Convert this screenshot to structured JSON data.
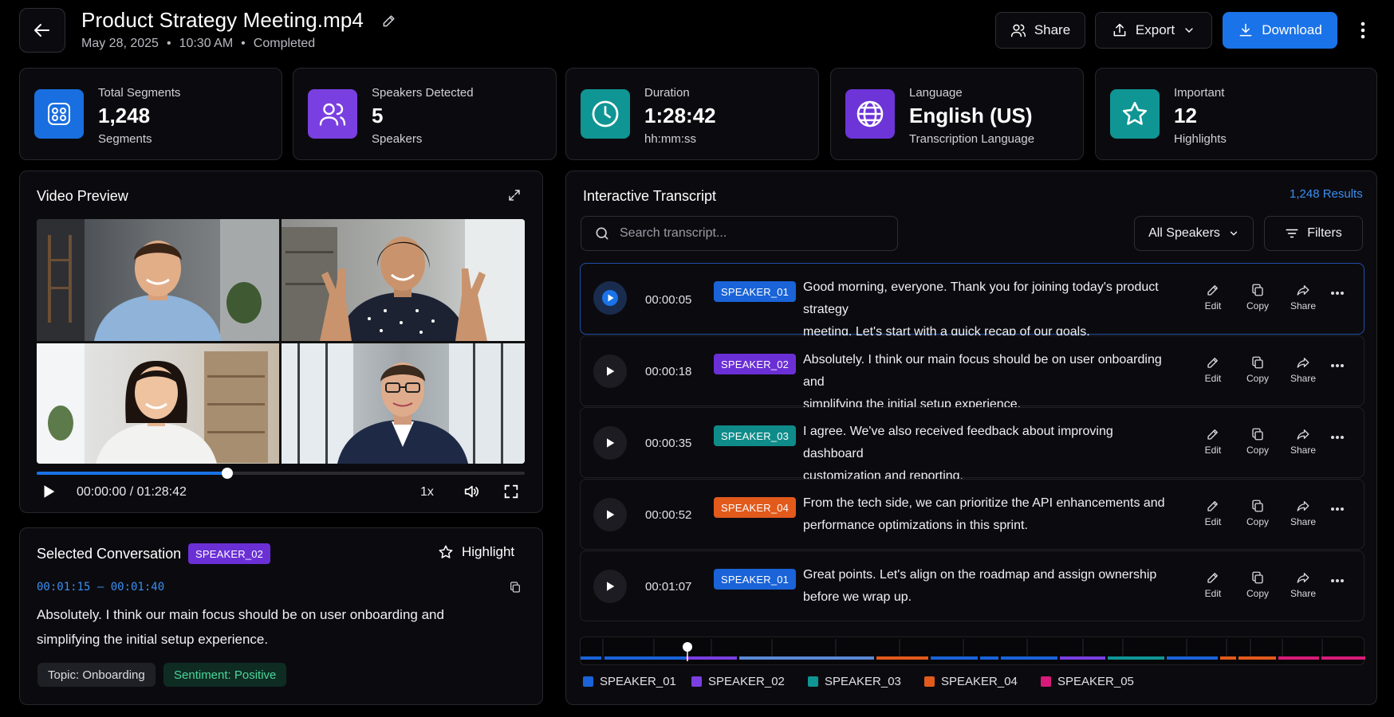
{
  "header": {
    "title": "Product Strategy Meeting.mp4",
    "date": "May 28, 2025",
    "time": "10:30 AM",
    "status": "Completed",
    "share_label": "Share",
    "export_label": "Export",
    "download_label": "Download"
  },
  "stats": [
    {
      "label": "Total Segments",
      "value": "1,248",
      "sub": "Segments",
      "icon": "segments-icon",
      "color": "#1a6fe0"
    },
    {
      "label": "Speakers Detected",
      "value": "5",
      "sub": "Speakers",
      "icon": "users-icon",
      "color": "#7a3fe0"
    },
    {
      "label": "Duration",
      "value": "1:28:42",
      "sub": "hh:mm:ss",
      "icon": "clock-icon",
      "color": "#0f9594"
    },
    {
      "label": "Language",
      "value": "English (US)",
      "sub": "Transcription Language",
      "icon": "globe-icon",
      "color": "#6d34d8"
    },
    {
      "label": "Important",
      "value": "12",
      "sub": "Highlights",
      "icon": "star-icon",
      "color": "#0f9594"
    }
  ],
  "video": {
    "title": "Video Preview",
    "current_time": "00:00:00",
    "total_time": "01:28:42",
    "separator": "/",
    "speed": "1x",
    "progress_fraction": 0.39
  },
  "selected": {
    "title": "Selected Conversation",
    "speaker": "SPEAKER_02",
    "highlight_label": "Highlight",
    "range": "00:01:15 – 00:01:40",
    "text": "Absolutely. I think our main focus should be on user onboarding and simplifying the initial setup experience.",
    "tags": [
      {
        "label": "Topic: Onboarding"
      },
      {
        "label": "Sentiment: Positive"
      }
    ]
  },
  "transcript": {
    "title": "Interactive Transcript",
    "results": "1,248 Results",
    "search_placeholder": "Search transcript...",
    "speaker_filter": "All Speakers",
    "filters_label": "Filters",
    "actions": {
      "edit": "Edit",
      "copy": "Copy",
      "share": "Share"
    },
    "rows": [
      {
        "time": "00:00:05",
        "speaker": "SPEAKER_01",
        "color": "#1a63d8",
        "line1": "Good morning, everyone. Thank you for joining today's product strategy",
        "line2": "meeting. Let's start with a quick recap of our goals."
      },
      {
        "time": "00:00:18",
        "speaker": "SPEAKER_02",
        "color": "#6b2fd6",
        "line1": "Absolutely. I think our main focus should be on user onboarding and",
        "line2": "simplifying the initial setup experience."
      },
      {
        "time": "00:00:35",
        "speaker": "SPEAKER_03",
        "color": "#0f8c8a",
        "line1": "I agree. We've also received feedback about improving dashboard",
        "line2": "customization and reporting."
      },
      {
        "time": "00:00:52",
        "speaker": "SPEAKER_04",
        "color": "#e25a1c",
        "line1": "From the tech side, we can prioritize the API enhancements and",
        "line2": "performance optimizations in this sprint."
      },
      {
        "time": "00:01:07",
        "speaker": "SPEAKER_01",
        "color": "#1a63d8",
        "line1": "Great points. Let's align on the roadmap and assign ownership",
        "line2": "before we wrap up."
      }
    ]
  },
  "timeline": {
    "legend": [
      {
        "name": "SPEAKER_01",
        "color": "#1a63d8"
      },
      {
        "name": "SPEAKER_02",
        "color": "#7a3fe0"
      },
      {
        "name": "SPEAKER_03",
        "color": "#0f9594"
      },
      {
        "name": "SPEAKER_04",
        "color": "#e25a1c"
      },
      {
        "name": "SPEAKER_05",
        "color": "#d81b7a"
      }
    ]
  }
}
